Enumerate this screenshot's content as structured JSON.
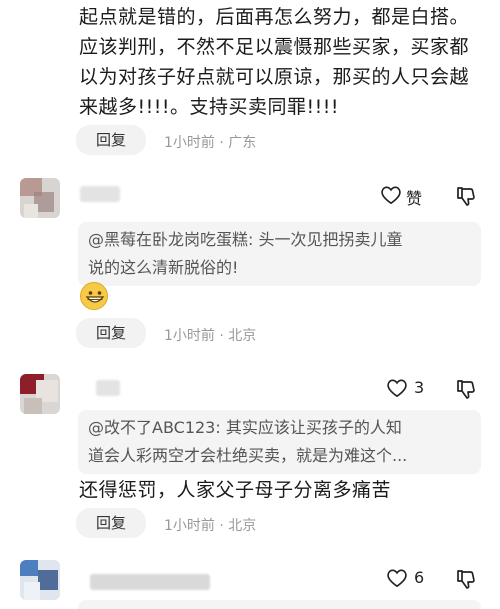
{
  "top_comment": {
    "lines": [
      "起点就是错的，后面再怎么努力，都是白搭。",
      "应该判刑，不然不足以震慑那些买家，买家都",
      "以为对孩子好点就可以原谅，那买的人只会越",
      "来越多!!!!。支持买卖同罪!!!!"
    ],
    "reply_label": "回复",
    "time": "1小时前",
    "location": "广东"
  },
  "comments": [
    {
      "like_label": "赞",
      "quote": [
        "@黑莓在卧龙岗吃蛋糕: 头一次见把拐卖儿童",
        "说的这么清新脱俗的!"
      ],
      "emoji": "grinning-emoji",
      "reply_label": "回复",
      "time": "1小时前",
      "location": "北京"
    },
    {
      "like_count": "3",
      "quote": [
        "@改不了ABC123: 其实应该让买孩子的人知",
        "道会人彩两空才会杜绝买卖，就是为难这个..."
      ],
      "text": "还得惩罚，人家父子母子分离多痛苦",
      "reply_label": "回复",
      "time": "1小时前",
      "location": "北京"
    },
    {
      "like_count": "6"
    }
  ],
  "separator": "·",
  "icons": [
    "heart-icon",
    "dislike-icon"
  ],
  "colors": {
    "pill_bg": "#f2f2f2",
    "meta": "#999999",
    "quote_bg": "#f4f4f4"
  }
}
